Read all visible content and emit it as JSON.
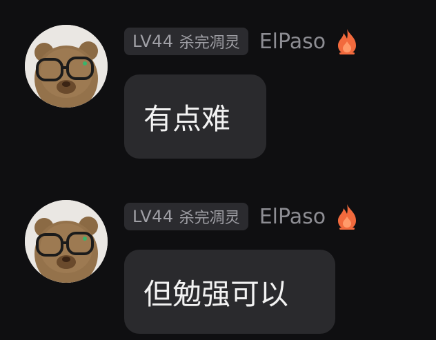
{
  "messages": [
    {
      "level": "LV44",
      "title": "杀完凋灵",
      "username": "ElPaso",
      "text": "有点难",
      "avatar_icon": "teddy-bear-with-glasses",
      "badge_icon": "flame-icon"
    },
    {
      "level": "LV44",
      "title": "杀完凋灵",
      "username": "ElPaso",
      "text": "但勉强可以",
      "avatar_icon": "teddy-bear-with-glasses",
      "badge_icon": "flame-icon"
    }
  ],
  "colors": {
    "background": "#0f0f11",
    "bubble": "#2a2a2d",
    "badge_bg": "#2b2b2f",
    "badge_text": "#a0a0a6",
    "username": "#8d8d93",
    "message_text": "#f2f2f2",
    "flame": "#f26a3d"
  }
}
